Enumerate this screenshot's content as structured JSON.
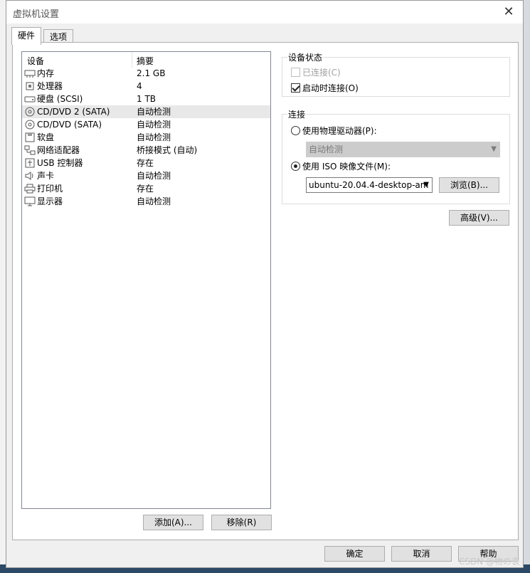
{
  "window": {
    "title": "虚拟机设置"
  },
  "tabs": [
    {
      "label": "硬件"
    },
    {
      "label": "选项"
    }
  ],
  "device_list": {
    "headers": {
      "device": "设备",
      "summary": "摘要"
    },
    "rows": [
      {
        "icon": "memory-icon",
        "name": "内存",
        "summary": "2.1 GB"
      },
      {
        "icon": "processor-icon",
        "name": "处理器",
        "summary": "4"
      },
      {
        "icon": "hard-disk-icon",
        "name": "硬盘 (SCSI)",
        "summary": "1 TB"
      },
      {
        "icon": "cd-dvd-icon",
        "name": "CD/DVD 2 (SATA)",
        "summary": "自动检测"
      },
      {
        "icon": "cd-dvd-icon",
        "name": "CD/DVD (SATA)",
        "summary": "自动检测"
      },
      {
        "icon": "floppy-icon",
        "name": "软盘",
        "summary": "自动检测"
      },
      {
        "icon": "network-adapter-icon",
        "name": "网络适配器",
        "summary": "桥接模式 (自动)"
      },
      {
        "icon": "usb-icon",
        "name": "USB 控制器",
        "summary": "存在"
      },
      {
        "icon": "sound-card-icon",
        "name": "声卡",
        "summary": "自动检测"
      },
      {
        "icon": "printer-icon",
        "name": "打印机",
        "summary": "存在"
      },
      {
        "icon": "display-icon",
        "name": "显示器",
        "summary": "自动检测"
      }
    ],
    "selected_row": "CD/DVD 2 (SATA)"
  },
  "list_buttons": {
    "add": "添加(A)...",
    "remove": "移除(R)"
  },
  "device_status": {
    "title": "设备状态",
    "connected": {
      "label": "已连接(C)",
      "checked": false,
      "enabled": false
    },
    "connect_at_power_on": {
      "label": "启动时连接(O)",
      "checked": true,
      "enabled": true
    }
  },
  "connection": {
    "title": "连接",
    "physical_drive": {
      "label": "使用物理驱动器(P):",
      "selected": false,
      "value": "自动检测"
    },
    "iso_image": {
      "label": "使用 ISO 映像文件(M):",
      "selected": true,
      "value": "ubuntu-20.04.4-desktop-am"
    },
    "browse": "浏览(B)..."
  },
  "advanced": "高级(V)...",
  "footer": {
    "ok": "确定",
    "cancel": "取消",
    "help": "帮助"
  },
  "watermark": "CSDN @物の衷"
}
